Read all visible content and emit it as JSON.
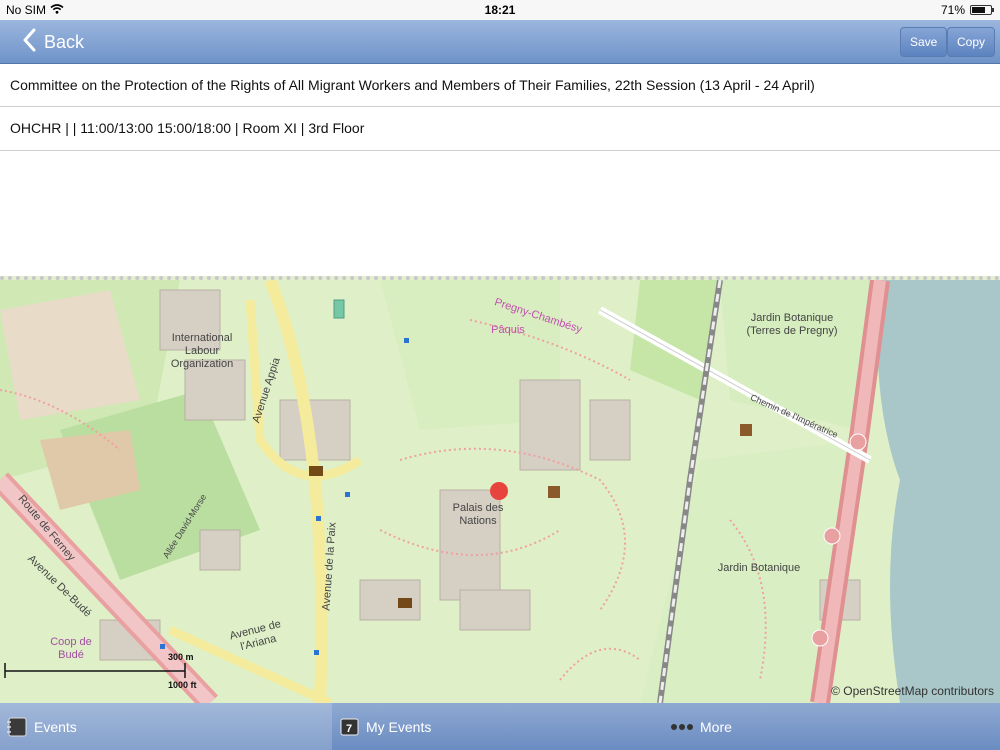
{
  "status_bar": {
    "carrier": "No SIM",
    "time": "18:21",
    "battery": "71%",
    "battery_level": 0.71
  },
  "nav": {
    "back_label": "Back",
    "save_label": "Save",
    "copy_label": "Copy",
    "color": "#7a9bcf"
  },
  "event": {
    "title": "Committee on the Protection of the Rights of All Migrant Workers and Members of Their Families, 22th Session (13 April - 24 April)",
    "details": "OHCHR |  | 11:00/13:00 15:00/18:00 | Room XI | 3rd Floor"
  },
  "map": {
    "labels": {
      "ilo": "International Labour Organization",
      "palais": "Palais des Nations",
      "jardin_botanique_terres": "Jardin Botanique (Terres de Pregny)",
      "jardin_botanique": "Jardin Botanique",
      "pregny": "Pregny-Chambésy",
      "paquis": "Pâquis",
      "avenue_appia": "Avenue Appia",
      "route_ferney": "Route de Ferney",
      "avenue_bude": "Avenue De-Budé",
      "avenue_paix": "Avenue de la Paix",
      "avenue_ariana": "Avenue de l'Ariana",
      "chemin_imperatrice": "Chemin de l'Impératrice",
      "allee_morse": "Allée David-Morse",
      "coop": "Coop de Budé"
    },
    "scale_meters": "300 m",
    "scale_feet": "1000 ft",
    "attribution": "© OpenStreetMap contributors",
    "marker_color": "#e8443e"
  },
  "tabs": {
    "events": "Events",
    "my_events": "My Events",
    "more": "More"
  }
}
